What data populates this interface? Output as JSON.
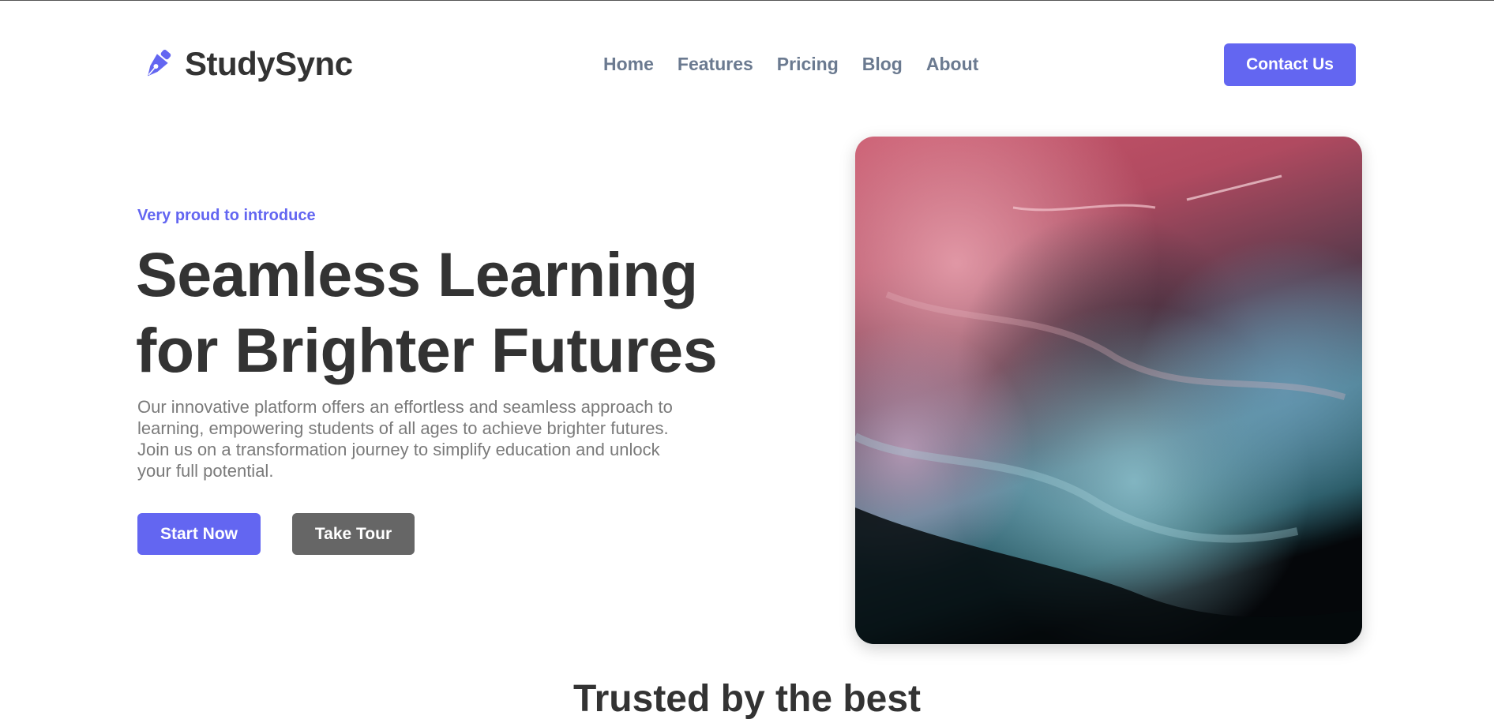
{
  "header": {
    "brand": "StudySync",
    "logo_icon": "pen-nib-icon",
    "nav": [
      {
        "label": "Home"
      },
      {
        "label": "Features"
      },
      {
        "label": "Pricing"
      },
      {
        "label": "Blog"
      },
      {
        "label": "About"
      }
    ],
    "contact_label": "Contact Us"
  },
  "hero": {
    "eyebrow": "Very proud to introduce",
    "headline_line1": "Seamless Learning",
    "headline_line2": "for Brighter Futures",
    "description": "Our innovative platform offers an effortless and seamless approach to learning, empowering students of all ages to achieve brighter futures. Join us on a transformation journey to simplify education and unlock your full potential.",
    "primary_cta": "Start Now",
    "secondary_cta": "Take Tour",
    "image": "abstract-fluid-art-image"
  },
  "trusted": {
    "title": "Trusted by the best"
  },
  "colors": {
    "accent": "#6366f1",
    "text_dark": "#333333",
    "nav_text": "#6b7a90",
    "body_text": "#7a7a7a",
    "secondary_button": "#666666"
  }
}
